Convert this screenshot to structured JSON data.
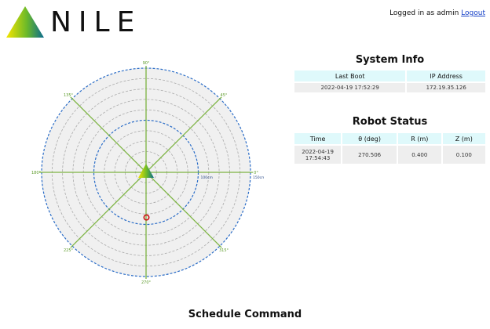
{
  "brand": {
    "name": "NILE"
  },
  "header": {
    "login_text": "Logged in as admin",
    "logout_label": "Logout"
  },
  "polar": {
    "angle_labels": [
      "0°",
      "45°",
      "90°",
      "135°",
      "180°",
      "225°",
      "270°",
      "315°"
    ],
    "radius_labels": [
      "150cm",
      "100cm"
    ],
    "robot_marker": {
      "theta_deg": 270.506,
      "r_m": 0.4,
      "color": "#cc1111"
    }
  },
  "system_info": {
    "title": "System Info",
    "headers": [
      "Last Boot",
      "IP Address"
    ],
    "row": [
      "2022-04-19 17:52:29",
      "172.19.35.126"
    ]
  },
  "robot_status": {
    "title": "Robot Status",
    "headers": [
      "Time",
      "θ (deg)",
      "R (m)",
      "Z (m)"
    ],
    "row": [
      "2022-04-19 17:54:43",
      "270.506",
      "0.400",
      "0.100"
    ]
  },
  "schedule": {
    "title": "Schedule Command"
  },
  "colors": {
    "grid_green": "#7cb342",
    "ring_blue": "#2a6cc7",
    "ring_gray": "#aaaaaa",
    "header_cell": "#dff9fb"
  }
}
